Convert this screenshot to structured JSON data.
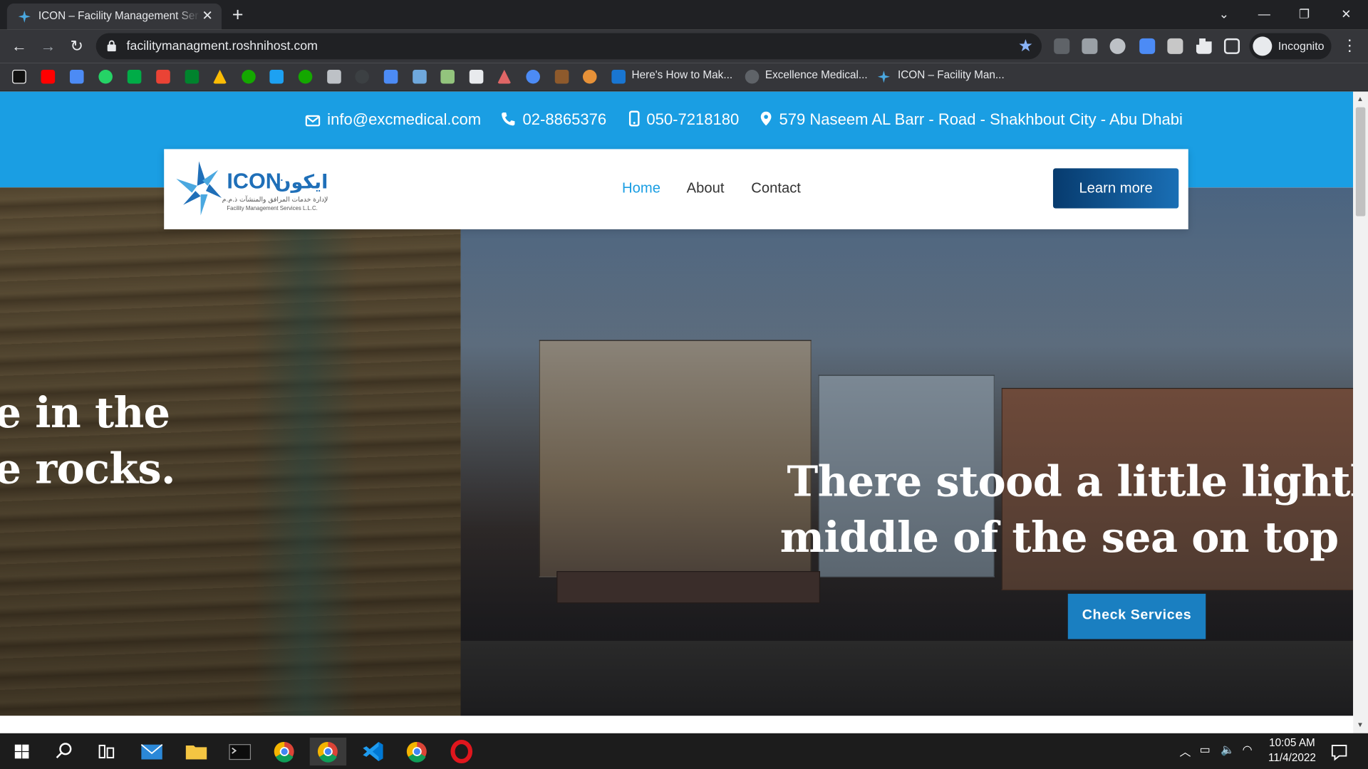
{
  "browser": {
    "tab_title": "ICON – Facility Management Ser",
    "url": "facilitymanagment.roshnihost.com",
    "profile": "Incognito",
    "bookmarks": [
      {
        "label": "Here's How to Mak..."
      },
      {
        "label": "Excellence Medical..."
      },
      {
        "label": "ICON – Facility Man..."
      }
    ]
  },
  "site": {
    "contact": {
      "email": "info@excmedical.com",
      "phone": "02-8865376",
      "mobile": "050-7218180",
      "address": "579 Naseem AL Barr - Road - Shakhbout City - Abu Dhabi"
    },
    "logo": {
      "latin": "ICON",
      "arabic": "ايكون",
      "subtitle_ar": "لإدارة خدمات المرافق والمنشآت ذ.م.م",
      "subtitle_en": "Facility Management Services L.L.C."
    },
    "nav": [
      "Home",
      "About",
      "Contact"
    ],
    "cta": "Learn more",
    "hero": {
      "left_line1": "e in the",
      "left_line2": "e rocks.",
      "line1": "There stood a little lighthouse",
      "line2": "middle of the sea on top of the",
      "button": "Check Services",
      "slides_total": 3,
      "active_slide": 3
    }
  },
  "taskbar": {
    "time": "10:05 AM",
    "date": "11/4/2022"
  },
  "colors": {
    "brand_blue": "#1a9ee3",
    "cta_dark": "#073b6e"
  }
}
